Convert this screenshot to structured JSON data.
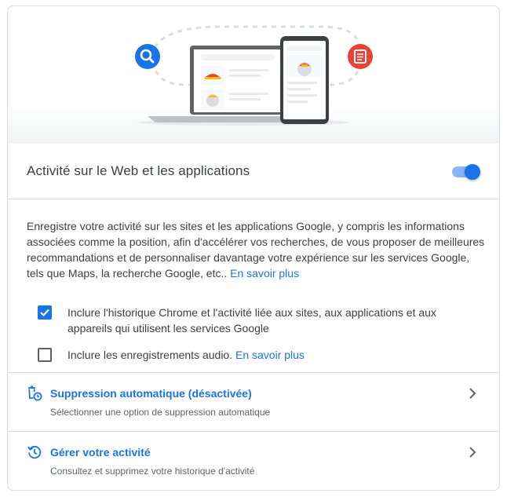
{
  "header": {
    "title": "Activité sur le Web et les applications",
    "toggle_on": true
  },
  "description": {
    "text": "Enregistre votre activité sur les sites et les applications Google, y compris les informations associées comme la position, afin d'accélérer vos recherches, de vous proposer de meilleures recommandations et de personnaliser davantage votre expérience sur les services Google, tels que Maps, la recherche Google, etc..",
    "link": "En savoir plus"
  },
  "checkboxes": [
    {
      "label": "Inclure l'historique Chrome et l'activité liée aux sites, aux applications et aux appareils qui utilisent les services Google",
      "checked": true
    },
    {
      "label": "Inclure les enregistrements audio.",
      "link": "En savoir plus",
      "checked": false
    }
  ],
  "rows": [
    {
      "icon": "auto-delete-icon",
      "title": "Suppression automatique (désactivée)",
      "subtitle": "Sélectionner une option de suppression automatique"
    },
    {
      "icon": "history-icon",
      "title": "Gérer votre activité",
      "subtitle": "Consultez et supprimez votre historique d'activité"
    }
  ],
  "illustration": {
    "left_icon": "search-icon",
    "right_icon": "document-icon"
  },
  "colors": {
    "accent": "#1a73e8",
    "toggle_track": "#8ab4f8",
    "search_badge": "#1a73e8",
    "doc_badge": "#ea4335"
  }
}
